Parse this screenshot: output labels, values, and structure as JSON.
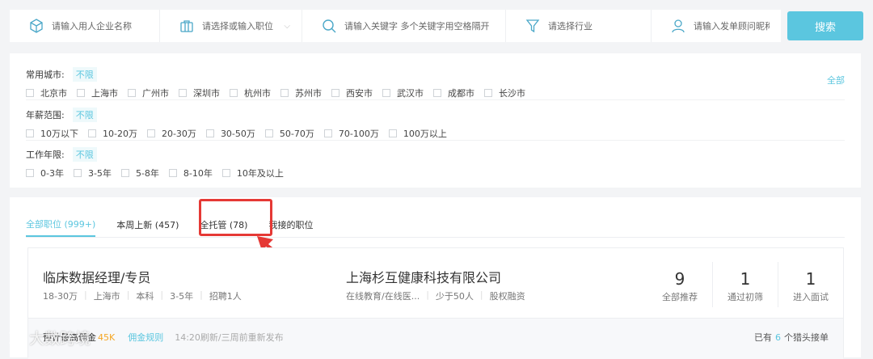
{
  "search": {
    "company_placeholder": "请输入用人企业名称",
    "position_placeholder": "请选择或输入职位",
    "keyword_placeholder": "请输入关键字 多个关键字用空格隔开",
    "industry_placeholder": "请选择行业",
    "advisor_placeholder": "请输入发单顾问昵称",
    "button_label": "搜索"
  },
  "filters": {
    "city": {
      "title": "常用城市:",
      "unlimited": "不限",
      "options": [
        "北京市",
        "上海市",
        "广州市",
        "深圳市",
        "杭州市",
        "苏州市",
        "西安市",
        "武汉市",
        "成都市",
        "长沙市"
      ],
      "all_label": "全部"
    },
    "salary": {
      "title": "年薪范围:",
      "unlimited": "不限",
      "options": [
        "10万以下",
        "10-20万",
        "20-30万",
        "30-50万",
        "50-70万",
        "70-100万",
        "100万以上"
      ]
    },
    "experience": {
      "title": "工作年限:",
      "unlimited": "不限",
      "options": [
        "0-3年",
        "3-5年",
        "5-8年",
        "8-10年",
        "10年及以上"
      ]
    }
  },
  "tabs": [
    {
      "label": "全部职位 (999+)",
      "active": true
    },
    {
      "label": "本周上新 (457)",
      "active": false
    },
    {
      "label": "全托管 (78)",
      "active": false
    },
    {
      "label": "我接的职位",
      "active": false
    }
  ],
  "job": {
    "title": "临床数据经理/专员",
    "meta": [
      "18-30万",
      "上海市",
      "本科",
      "3-5年",
      "招聘1人"
    ],
    "company": "上海杉互健康科技有限公司",
    "company_meta": [
      "在线教育/在线医...",
      "少于50人",
      "股权融资"
    ],
    "stats": [
      {
        "value": "9",
        "label": "全部推荐"
      },
      {
        "value": "1",
        "label": "通过初筛"
      },
      {
        "value": "1",
        "label": "进入面试"
      }
    ],
    "footer": {
      "commission_label": "预计最高佣金",
      "commission_value": "45K",
      "rule_label": "佣金规则",
      "refresh_text": "14:20刷新/三周前重新发布",
      "hunters_prefix": "已有",
      "hunters_count": "6",
      "hunters_suffix": "个猎头接单"
    }
  },
  "watermark": "大数跨境",
  "colors": {
    "accent": "#5bc6df",
    "highlight": "#e53935",
    "commission": "#f5a623"
  }
}
